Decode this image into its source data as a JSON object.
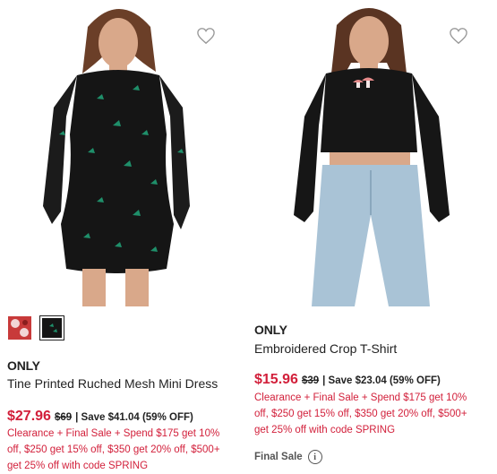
{
  "products": [
    {
      "brand": "ONLY",
      "name": "Tine Printed Ruched Mesh Mini Dress",
      "sale_price": "$27.96",
      "original_price": "$69",
      "savings": "| Save $41.04 (59% OFF)",
      "promo": "Clearance + Final Sale + Spend $175 get 10% off, $250 get 15% off, $350 get 20% off, $500+ get 25% off with code SPRING",
      "swatches": [
        "red floral",
        "black butterfly"
      ]
    },
    {
      "brand": "ONLY",
      "name": "Embroidered Crop T-Shirt",
      "sale_price": "$15.96",
      "original_price": "$39",
      "savings": "| Save $23.04 (59% OFF)",
      "promo": "Clearance + Final Sale + Spend $175 get 10% off, $250 get 15% off, $350 get 20% off, $500+ get 25% off with code SPRING",
      "final_sale_label": "Final Sale"
    }
  ],
  "colors": {
    "sale_red": "#d21f3a",
    "text_dark": "#222222"
  },
  "icons": {
    "wishlist": "heart-outline-icon",
    "info": "info-circle-icon"
  }
}
